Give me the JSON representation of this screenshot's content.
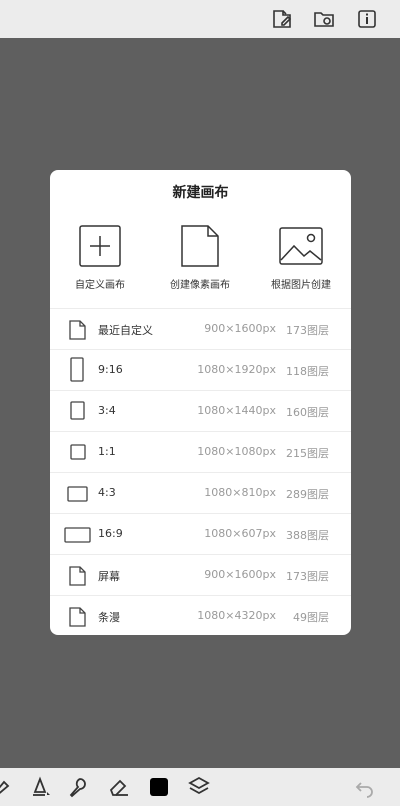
{
  "dialog": {
    "title": "新建画布",
    "quick_actions": [
      {
        "label": "自定义画布",
        "icon": "add-square-icon"
      },
      {
        "label": "创建像素画布",
        "icon": "blank-file-icon"
      },
      {
        "label": "根据图片创建",
        "icon": "image-icon"
      }
    ],
    "presets": [
      {
        "name": "最近自定义",
        "size": "900×1600px",
        "layers": "173图层",
        "icon": "file-icon"
      },
      {
        "name": "9:16",
        "size": "1080×1920px",
        "layers": "118图层",
        "icon": "ratio-9-16-icon"
      },
      {
        "name": "3:4",
        "size": "1080×1440px",
        "layers": "160图层",
        "icon": "ratio-3-4-icon"
      },
      {
        "name": "1:1",
        "size": "1080×1080px",
        "layers": "215图层",
        "icon": "ratio-1-1-icon"
      },
      {
        "name": "4:3",
        "size": "1080×810px",
        "layers": "289图层",
        "icon": "ratio-4-3-icon"
      },
      {
        "name": "16:9",
        "size": "1080×607px",
        "layers": "388图层",
        "icon": "ratio-16-9-icon"
      },
      {
        "name": "屏幕",
        "size": "900×1600px",
        "layers": "173图层",
        "icon": "file-icon"
      },
      {
        "name": "条漫",
        "size": "1080×4320px",
        "layers": "49图层",
        "icon": "file-icon"
      }
    ]
  },
  "colors": {
    "bar": "#ececec",
    "scrim": "#5f5f5f",
    "dialog": "#ffffff",
    "muted_text": "#9a9a9a"
  }
}
